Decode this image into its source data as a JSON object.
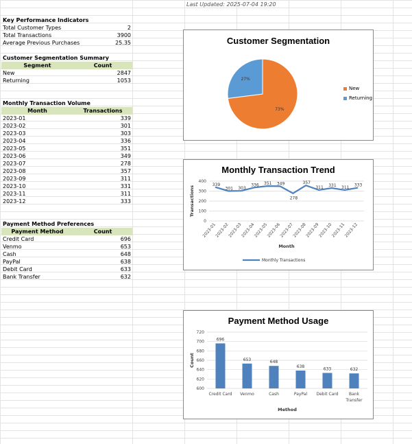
{
  "header": {
    "last_updated": "Last Updated: 2025-07-04 19:20"
  },
  "kpi": {
    "title": "Key Performance Indicators",
    "rows": [
      {
        "label": "Total Customer Types",
        "value": "2"
      },
      {
        "label": "Total Transactions",
        "value": "3900"
      },
      {
        "label": "Average Previous Purchases",
        "value": "25.35"
      }
    ]
  },
  "segmentation": {
    "title": "Customer Segmentation Summary",
    "col1": "Segment",
    "col2": "Count",
    "rows": [
      {
        "label": "New",
        "value": "2847"
      },
      {
        "label": "Returning",
        "value": "1053"
      }
    ]
  },
  "monthly": {
    "title": "Monthly Transaction Volume",
    "col1": "Month",
    "col2": "Transactions",
    "rows": [
      {
        "label": "2023-01",
        "value": "339"
      },
      {
        "label": "2023-02",
        "value": "301"
      },
      {
        "label": "2023-03",
        "value": "303"
      },
      {
        "label": "2023-04",
        "value": "336"
      },
      {
        "label": "2023-05",
        "value": "351"
      },
      {
        "label": "2023-06",
        "value": "349"
      },
      {
        "label": "2023-07",
        "value": "278"
      },
      {
        "label": "2023-08",
        "value": "357"
      },
      {
        "label": "2023-09",
        "value": "311"
      },
      {
        "label": "2023-10",
        "value": "331"
      },
      {
        "label": "2023-11",
        "value": "311"
      },
      {
        "label": "2023-12",
        "value": "333"
      }
    ]
  },
  "payment": {
    "title": "Payment Method Preferences",
    "col1": "Payment Method",
    "col2": "Count",
    "rows": [
      {
        "label": "Credit Card",
        "value": "696"
      },
      {
        "label": "Venmo",
        "value": "653"
      },
      {
        "label": "Cash",
        "value": "648"
      },
      {
        "label": "PayPal",
        "value": "638"
      },
      {
        "label": "Debit Card",
        "value": "633"
      },
      {
        "label": "Bank Transfer",
        "value": "632"
      }
    ]
  },
  "charts": {
    "pie": {
      "title": "Customer Segmentation",
      "legend": [
        "New",
        "Returning"
      ],
      "labels": [
        "73%",
        "27%"
      ]
    },
    "line": {
      "title": "Monthly Transaction Trend",
      "xlabel": "Month",
      "ylabel": "Transactions",
      "legend": "Monthly Transactions"
    },
    "bar": {
      "title": "Payment Method Usage",
      "xlabel": "Method",
      "ylabel": "Count"
    }
  },
  "colors": {
    "new": "#ed7d31",
    "returning": "#5b9bd5",
    "series": "#4f81bd",
    "header_fill": "#d8e4bc"
  },
  "chart_data": [
    {
      "type": "pie",
      "title": "Customer Segmentation",
      "categories": [
        "New",
        "Returning"
      ],
      "values": [
        2847,
        1053
      ],
      "percent_labels": [
        "73%",
        "27%"
      ],
      "legend": "right"
    },
    {
      "type": "line",
      "title": "Monthly Transaction Trend",
      "xlabel": "Month",
      "ylabel": "Transactions",
      "categories": [
        "2023-01",
        "2023-02",
        "2023-03",
        "2023-04",
        "2023-05",
        "2023-06",
        "2023-07",
        "2023-08",
        "2023-09",
        "2023-10",
        "2023-11",
        "2023-12"
      ],
      "series": [
        {
          "name": "Monthly Transactions",
          "values": [
            339,
            301,
            303,
            336,
            351,
            349,
            278,
            357,
            311,
            331,
            311,
            333
          ]
        }
      ],
      "ylim": [
        0,
        400
      ],
      "yticks": [
        0,
        100,
        200,
        300,
        400
      ],
      "grid": true,
      "legend": "bottom"
    },
    {
      "type": "bar",
      "title": "Payment Method Usage",
      "xlabel": "Method",
      "ylabel": "Count",
      "categories": [
        "Credit Card",
        "Venmo",
        "Cash",
        "PayPal",
        "Debit Card",
        "Bank Transfer"
      ],
      "values": [
        696,
        653,
        648,
        638,
        633,
        632
      ],
      "ylim": [
        600,
        720
      ],
      "yticks": [
        600,
        620,
        640,
        660,
        680,
        700,
        720
      ],
      "grid": true
    }
  ]
}
